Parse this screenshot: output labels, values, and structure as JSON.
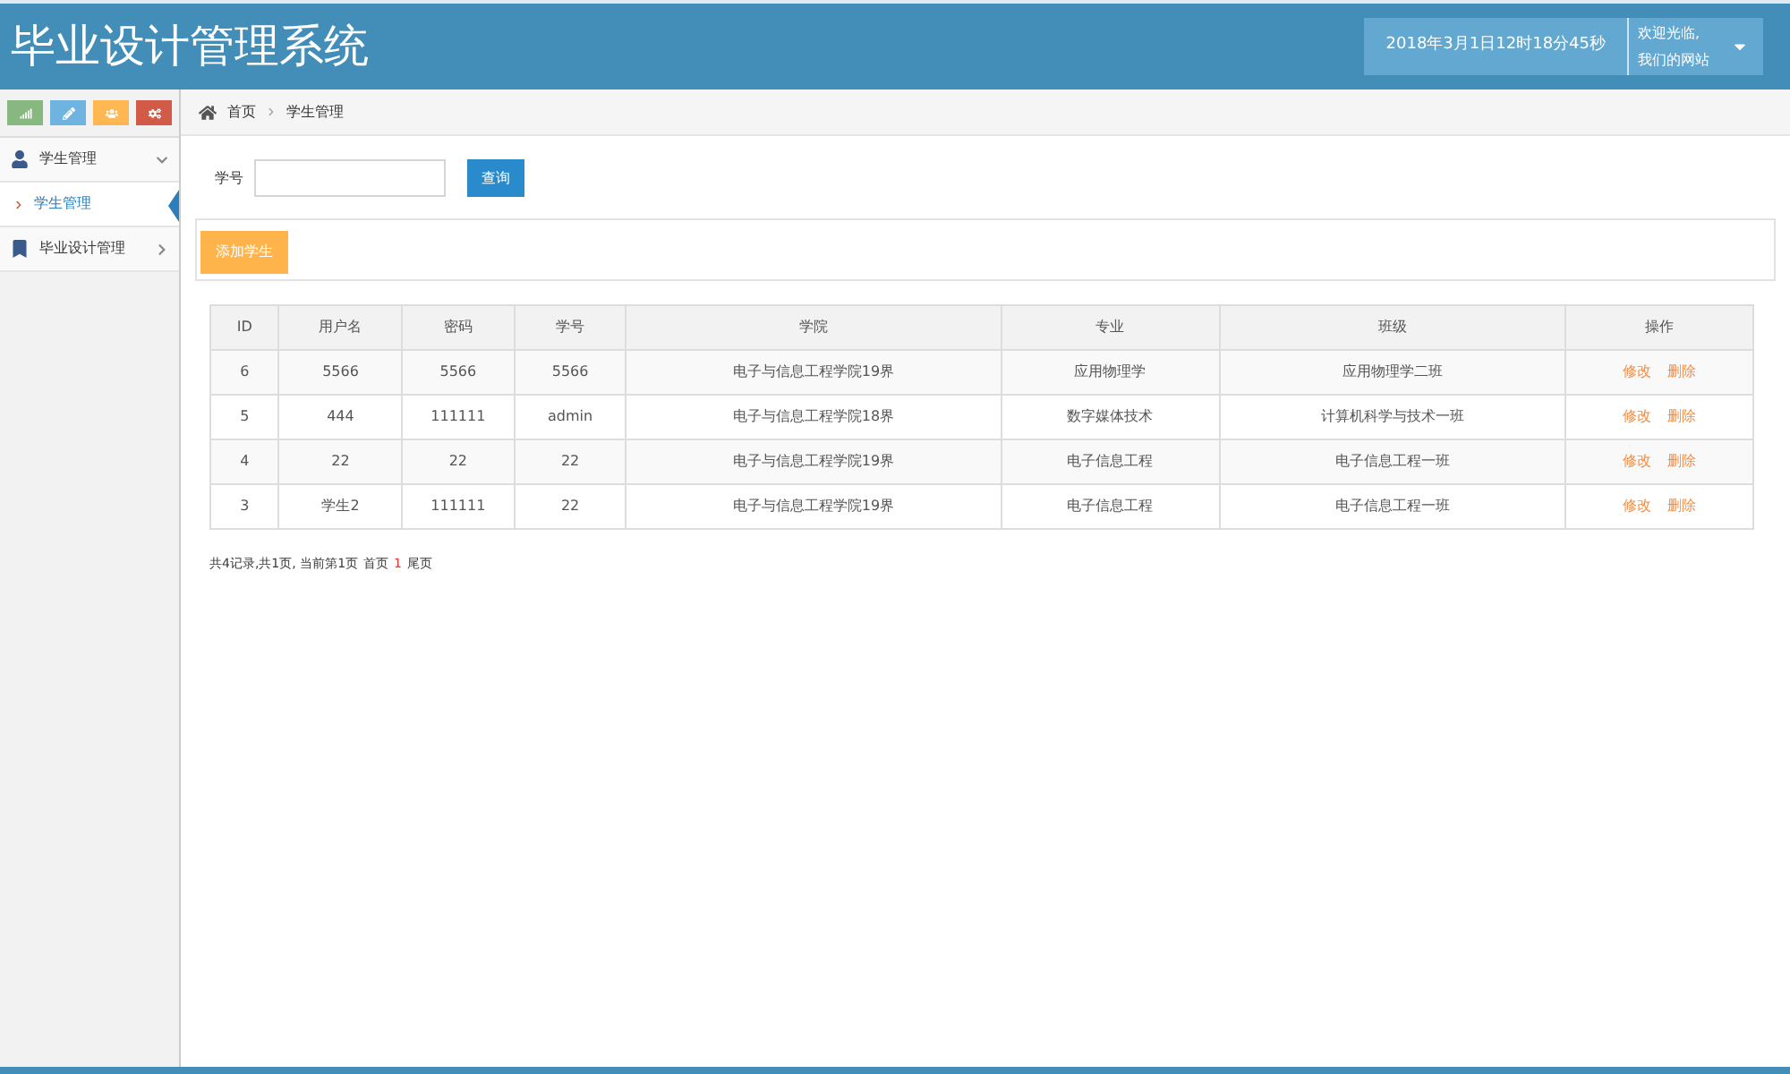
{
  "header": {
    "title": "毕业设计管理系统",
    "datetime": "2018年3月1日12时18分45秒",
    "welcome_lines": [
      "欢迎光临,",
      "我们的网站"
    ]
  },
  "shortcuts": [
    {
      "kind": "chart",
      "color": "#87b87f"
    },
    {
      "kind": "pencil",
      "color": "#6fb3e0"
    },
    {
      "kind": "users",
      "color": "#ffb752"
    },
    {
      "kind": "cogs",
      "color": "#d15b47"
    }
  ],
  "sidebar": {
    "items": [
      {
        "kind": "user",
        "label": "学生管理",
        "expanded": true,
        "children": [
          {
            "label": "学生管理",
            "selected": true
          }
        ]
      },
      {
        "kind": "bookmark",
        "label": "毕业设计管理",
        "expanded": false
      }
    ]
  },
  "breadcrumb": [
    "首页",
    "学生管理"
  ],
  "search": {
    "label": "学号",
    "button": "查询"
  },
  "add_button": "添加学生",
  "table": {
    "columns": [
      "ID",
      "用户名",
      "密码",
      "学号",
      "学院",
      "专业",
      "班级",
      "操作"
    ],
    "rows": [
      {
        "cells": [
          "6",
          "5566",
          "5566",
          "5566",
          "电子与信息工程学院19界",
          "应用物理学",
          "应用物理学二班"
        ],
        "actions": [
          "修改",
          "删除"
        ]
      },
      {
        "cells": [
          "5",
          "444",
          "111111",
          "admin",
          "电子与信息工程学院18界",
          "数字媒体技术",
          "计算机科学与技术一班"
        ],
        "actions": [
          "修改",
          "删除"
        ]
      },
      {
        "cells": [
          "4",
          "22",
          "22",
          "22",
          "电子与信息工程学院19界",
          "电子信息工程",
          "电子信息工程一班"
        ],
        "actions": [
          "修改",
          "删除"
        ]
      },
      {
        "cells": [
          "3",
          "学生2",
          "111111",
          "22",
          "电子与信息工程学院19界",
          "电子信息工程",
          "电子信息工程一班"
        ],
        "actions": [
          "修改",
          "删除"
        ]
      }
    ]
  },
  "pagination": {
    "summary": "共4记录,共1页, 当前第1页",
    "first": "首页",
    "pages": [
      {
        "label": "1",
        "selected": true
      }
    ],
    "last": "尾页"
  }
}
